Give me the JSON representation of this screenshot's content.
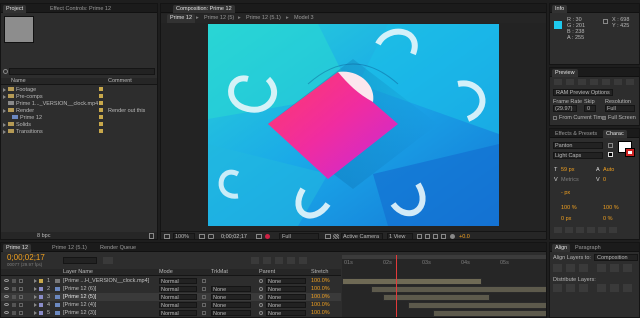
{
  "project": {
    "tab": "Project",
    "effect_tab": "Effect Controls: Prime 12",
    "search_placeholder": "",
    "col_name": "Name",
    "col_comment": "Comment",
    "items": [
      {
        "label": "Footage",
        "type": "folder",
        "comment": "",
        "color": "#c8a84b"
      },
      {
        "label": "Pre-comps",
        "type": "folder",
        "comment": "",
        "color": "#c8a84b"
      },
      {
        "label": "Prime 1..._VERSION__clock.mp4",
        "type": "footage",
        "comment": "",
        "color": "#c8a84b"
      },
      {
        "label": "Render",
        "type": "folder",
        "comment": "Render out this",
        "color": "#c8a84b"
      },
      {
        "label": "Prime 12",
        "type": "comp",
        "comment": "",
        "color": "#c8a84b"
      },
      {
        "label": "Solids",
        "type": "folder",
        "comment": "",
        "color": "#c8a84b"
      },
      {
        "label": "Transitions",
        "type": "folder",
        "comment": "",
        "color": "#c8a84b"
      }
    ],
    "bpc": "8 bpc"
  },
  "composition": {
    "panel_tab": "Composition: Prime 12",
    "tabs": [
      "Prime 12",
      "Prime 12 (5)",
      "Prime 12 (5.1)",
      "Model 3"
    ],
    "active_tab": 0,
    "zoom": "100%",
    "timecode": "0;00;02;17",
    "resolution": "Full",
    "view": "Active Camera",
    "views": "1 View",
    "exposure": "+0.0"
  },
  "info": {
    "tab": "Info",
    "r": "R : 30",
    "g": "G : 201",
    "b": "B : 238",
    "a": "A : 255",
    "x": "X : 698",
    "y": "Y : 425",
    "swatch": "#1ec9ee"
  },
  "preview": {
    "tab": "Preview",
    "options": "RAM Preview Options",
    "frame_rate_label": "Frame Rate",
    "skip_label": "Skip",
    "resolution_label": "Resolution",
    "frame_rate": "(29.97)",
    "skip": "0",
    "resolution": "Full",
    "from_current": "From Current Time",
    "full_screen": "Full Screen"
  },
  "effects": {
    "tab": "Effects & Presets",
    "char_tab": "Charac",
    "font": "Panton",
    "style": "Light Caps",
    "size": "59 px",
    "leading": "Auto",
    "tracking": "0",
    "metrics": "Metrics",
    "px": "- px",
    "scale_v": "100 %",
    "scale_h": "100 %",
    "baseline": "0 px",
    "tsume": "0 %"
  },
  "timeline": {
    "tabs": [
      "Prime 12",
      "Prime 12 (5.1)",
      "Render Queue"
    ],
    "timecode": "0;00;02;17",
    "frames": "00077 (29.97 fps)",
    "search_placeholder": "",
    "col_layer_name": "Layer Name",
    "col_mode": "Mode",
    "col_trkmat": "TrkMat",
    "col_parent": "Parent",
    "col_stretch": "Stretch",
    "ruler": [
      "01s",
      "02s",
      "03s",
      "04s",
      "05s"
    ],
    "playhead_pct": 0.26,
    "layers": [
      {
        "num": "1",
        "name": "[Prime ...H_VERSION__clock.mp4]",
        "mode": "Normal",
        "trkmat": "",
        "parent": "None",
        "stretch": "100.0%",
        "color": "#c8a84b",
        "bar_start": 0.0,
        "bar_end": 0.68
      },
      {
        "num": "2",
        "name": "[Prime 12 (6)]",
        "mode": "Normal",
        "trkmat": "None",
        "parent": "None",
        "stretch": "100.0%",
        "color": "#8a8cc8",
        "bar_start": 0.14,
        "bar_end": 1.0
      },
      {
        "num": "3",
        "name": "[Prime 12 (5)]",
        "mode": "Normal",
        "trkmat": "None",
        "parent": "None",
        "stretch": "100.0%",
        "color": "#8a8cc8",
        "bar_start": 0.2,
        "bar_end": 0.72
      },
      {
        "num": "4",
        "name": "[Prime 12 (4)]",
        "mode": "Normal",
        "trkmat": "None",
        "parent": "None",
        "stretch": "100.0%",
        "color": "#8a8cc8",
        "bar_start": 0.32,
        "bar_end": 1.0
      },
      {
        "num": "5",
        "name": "[Prime 12 (3)]",
        "mode": "Normal",
        "trkmat": "None",
        "parent": "None",
        "stretch": "100.0%",
        "color": "#8a8cc8",
        "bar_start": 0.44,
        "bar_end": 1.0
      }
    ]
  },
  "align": {
    "tab": "Align",
    "paragraph_tab": "Paragraph",
    "align_to_label": "Align Layers to:",
    "align_to": "Composition",
    "distribute_label": "Distribute Layers:"
  }
}
